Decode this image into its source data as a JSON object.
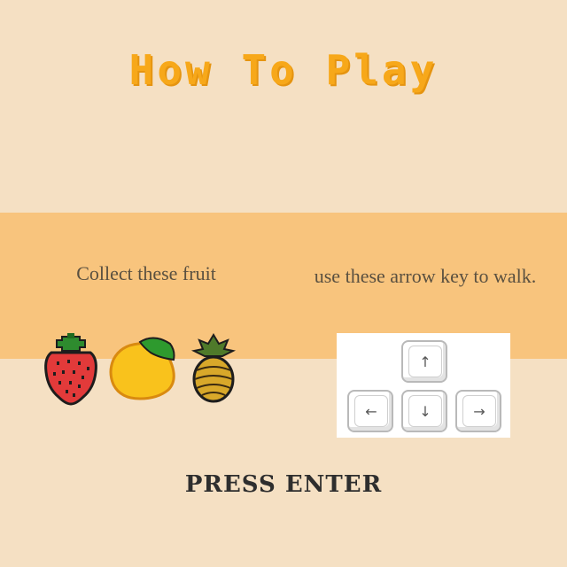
{
  "screen": {
    "title": "How To Play",
    "collect_text": "Collect these fruit",
    "walk_text": "use these arrow key to walk.",
    "press_text": "PRESS ENTER"
  },
  "fruits": [
    {
      "name": "strawberry",
      "icon": "strawberry-icon"
    },
    {
      "name": "mango",
      "icon": "mango-icon"
    },
    {
      "name": "pineapple",
      "icon": "pineapple-icon"
    }
  ],
  "keys": {
    "up": "↑",
    "left": "←",
    "down": "↓",
    "right": "→"
  },
  "colors": {
    "background": "#f5e0c3",
    "band": "#f8c47d",
    "title": "#f7a81a",
    "press": "#2e2e2e"
  }
}
